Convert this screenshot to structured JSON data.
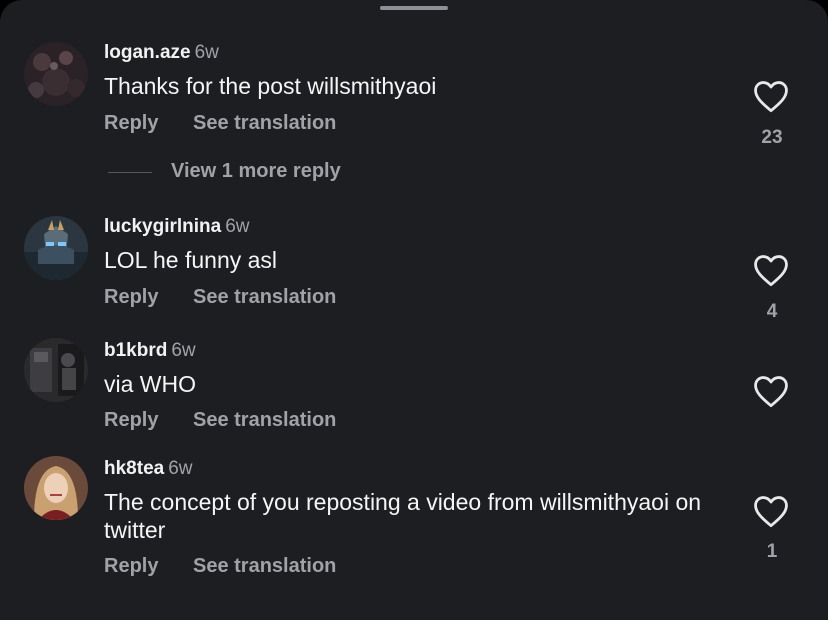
{
  "comments": [
    {
      "username": "logan.aze",
      "age": "6w",
      "text": "Thanks for the post willsmithyaoi",
      "reply_label": "Reply",
      "translate_label": "See translation",
      "likes": "23",
      "view_more": "View 1 more reply"
    },
    {
      "username": "luckygirlnina",
      "age": "6w",
      "text": "LOL he funny asl",
      "reply_label": "Reply",
      "translate_label": "See translation",
      "likes": "4"
    },
    {
      "username": "b1kbrd",
      "age": "6w",
      "text": "via WHO",
      "reply_label": "Reply",
      "translate_label": "See translation"
    },
    {
      "username": "hk8tea",
      "age": "6w",
      "text": "The concept of you reposting a video from willsmithyaoi on twitter",
      "reply_label": "Reply",
      "translate_label": "See translation",
      "likes": "1"
    }
  ],
  "icons": {
    "like": "heart-outline-icon"
  },
  "colors": {
    "background": "#1c1e22",
    "text": "#f5f5f5",
    "muted": "#a0a2a8"
  }
}
